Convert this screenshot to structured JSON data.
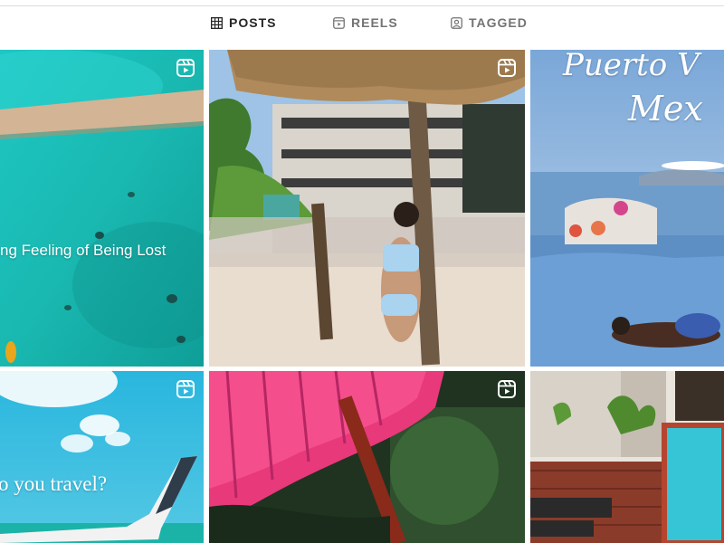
{
  "tabs": [
    {
      "label": "POSTS",
      "icon": "grid-icon",
      "active": true
    },
    {
      "label": "REELS",
      "icon": "reels-icon",
      "active": false
    },
    {
      "label": "TAGGED",
      "icon": "tagged-icon",
      "active": false
    }
  ],
  "posts": [
    {
      "overlay_text": "ng Feeling of Being Lost",
      "reel": true
    },
    {
      "overlay_text": "",
      "reel": true
    },
    {
      "overlay_text_line1": "Puerto V",
      "overlay_text_line2": "Mex",
      "reel": false
    },
    {
      "overlay_text": "o you travel?",
      "reel": true
    },
    {
      "overlay_text": "",
      "reel": true
    },
    {
      "overlay_text": "",
      "reel": false
    }
  ],
  "colors": {
    "active_tab": "#262626",
    "inactive_tab": "#737373",
    "divider": "#dbdbdb"
  }
}
